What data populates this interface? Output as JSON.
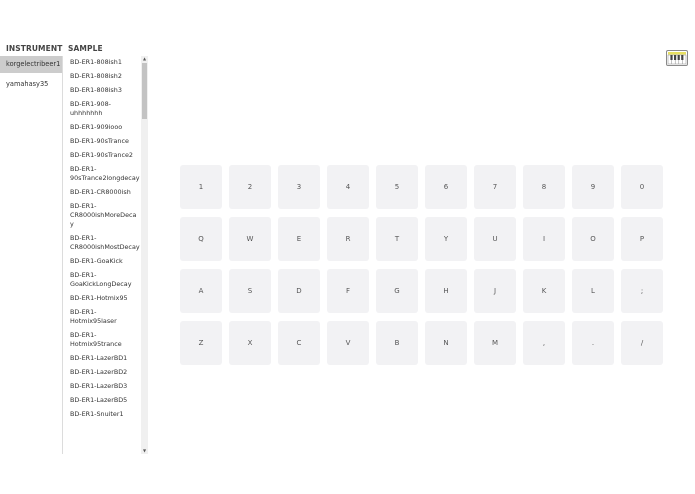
{
  "headers": {
    "instrument": "INSTRUMENT",
    "sample": "SAMPLE"
  },
  "instruments": [
    {
      "label": "korgelectribeer1",
      "selected": true
    },
    {
      "label": "yamahasy35",
      "selected": false
    }
  ],
  "samples": [
    "BD-ER1-808ish1",
    "BD-ER1-808ish2",
    "BD-ER1-808ish3",
    "BD-ER1-908-uhhhhhhh",
    "BD-ER1-909iooo",
    "BD-ER1-90sTrance",
    "BD-ER1-90sTrance2",
    "BD-ER1-90sTrance2longdecay",
    "BD-ER1-CR8000ish",
    "BD-ER1-CR8000ishMoreDecay",
    "BD-ER1-CR8000ishMostDecay",
    "BD-ER1-GoaKick",
    "BD-ER1-GoaKickLongDecay",
    "BD-ER1-Hotmix95",
    "BD-ER1-Hotmix95laser",
    "BD-ER1-Hotmix95trance",
    "BD-ER1-LazerBD1",
    "BD-ER1-LazerBD2",
    "BD-ER1-LazerBD3",
    "BD-ER1-LazerBD5",
    "BD-ER1-Snuiter1"
  ],
  "keyboard_rows": [
    [
      "1",
      "2",
      "3",
      "4",
      "5",
      "6",
      "7",
      "8",
      "9",
      "0"
    ],
    [
      "Q",
      "W",
      "E",
      "R",
      "T",
      "Y",
      "U",
      "I",
      "O",
      "P"
    ],
    [
      "A",
      "S",
      "D",
      "F",
      "G",
      "H",
      "J",
      "K",
      "L",
      ";"
    ],
    [
      "Z",
      "X",
      "C",
      "V",
      "B",
      "N",
      "M",
      ",",
      ".",
      "/"
    ]
  ],
  "icons": {
    "piano": "piano-icon"
  },
  "colors": {
    "selected_bg": "#cccccc",
    "key_bg": "#f2f2f4",
    "icon_accent": "#e8e060"
  }
}
